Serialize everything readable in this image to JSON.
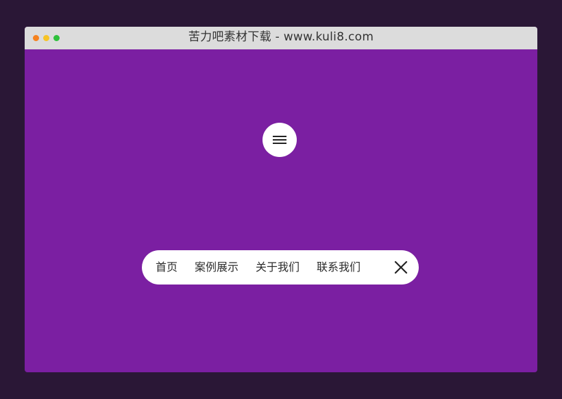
{
  "window": {
    "title": "苦力吧素材下载 - www.kuli8.com",
    "traffic_lights": [
      "#f5821f",
      "#f7c325",
      "#2ec13c"
    ]
  },
  "colors": {
    "content_background": "#7b1fa2",
    "outer_background": "#2a1736",
    "titlebar": "#dcdcdc"
  },
  "menu_toggle": {
    "icon": "hamburger-menu-icon"
  },
  "nav": {
    "items": [
      {
        "label": "首页"
      },
      {
        "label": "案例展示"
      },
      {
        "label": "关于我们"
      },
      {
        "label": "联系我们"
      }
    ],
    "close_icon": "close-icon"
  }
}
